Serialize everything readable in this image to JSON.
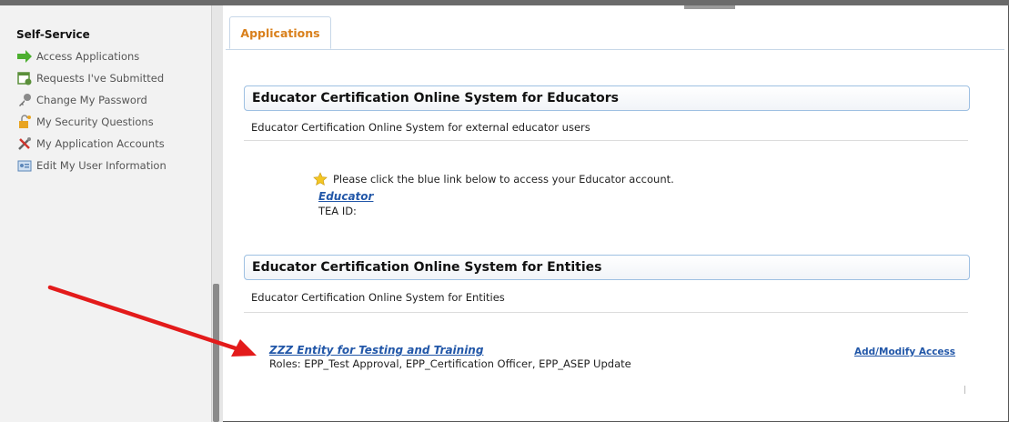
{
  "sidebar": {
    "title": "Self-Service",
    "items": [
      {
        "label": "Access Applications",
        "icon": "green-arrow-icon"
      },
      {
        "label": "Requests I've Submitted",
        "icon": "request-icon"
      },
      {
        "label": "Change My Password",
        "icon": "key-icon"
      },
      {
        "label": "My Security Questions",
        "icon": "lock-icon"
      },
      {
        "label": "My Application Accounts",
        "icon": "tools-icon"
      },
      {
        "label": "Edit My User Information",
        "icon": "user-card-icon"
      }
    ]
  },
  "tabs": [
    {
      "label": "Applications",
      "active": true
    }
  ],
  "sections": [
    {
      "header": "Educator Certification Online System for Educators",
      "description": "Educator Certification Online System for external educator users",
      "notice": "Please click the blue link below to access your Educator account.",
      "link": "Educator",
      "detail": "TEA ID:"
    },
    {
      "header": "Educator Certification Online System for Entities",
      "description": "Educator Certification Online System for Entities",
      "link": "ZZZ Entity for Testing and Training",
      "roles": "Roles: EPP_Test Approval, EPP_Certification Officer, EPP_ASEP Update",
      "action": "Add/Modify Access"
    }
  ],
  "colors": {
    "tab_text": "#d9801c",
    "link": "#2257a8",
    "header_border": "#9ec0e2",
    "annotation_arrow": "#e31b1b"
  }
}
